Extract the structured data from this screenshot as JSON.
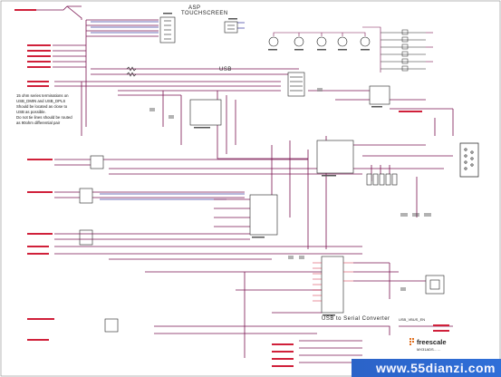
{
  "sections": {
    "touchscreen_title_1": "ASP",
    "touchscreen_title_2": "TOUCHSCREEN",
    "usb_title": "USB",
    "usb_serial_title": "USB to Serial Converter"
  },
  "note_lines": [
    "15 ohm series terminations on",
    "USB_DMIN and USB_DPLS",
    "Should be located as close to",
    "USB as possible.",
    "Do not tie lines should be routed",
    "as 90ohm differential pair"
  ],
  "net_labels": {
    "usb_vbus_en": "USB_VBUS_EN"
  },
  "title_block": {
    "company": "freescale",
    "doc_name": "MX31ADS……"
  },
  "watermark": "www.55dianzi.com",
  "colors": {
    "wire": "#7a1450",
    "bus_blue": "#4040a0",
    "label_red": "#d0203a",
    "component": "#222222"
  }
}
